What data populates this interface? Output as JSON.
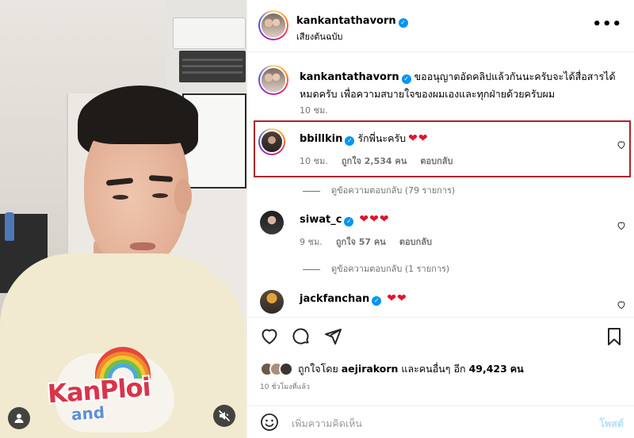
{
  "post": {
    "author": "kankantathavorn",
    "audio_label": "เสียงต้นฉบับ",
    "more_label": "•••",
    "caption": {
      "username": "kankantathavorn",
      "text": "ขออนุญาตอัดคลิปแล้วกันนะครับจะได้สื่อสารได้หมดครับ เพื่อความสบายใจของผมเองและทุกฝ่ายด้วยครับผม",
      "time": "10 ชม."
    }
  },
  "comments": [
    {
      "username": "bbillkin",
      "text": "รักพี่นะครับ",
      "hearts": "❤❤",
      "time": "10 ชม.",
      "likes": "ถูกใจ 2,534 คน",
      "reply": "ตอบกลับ",
      "replies_label": "ดูข้อความตอบกลับ (79 รายการ)"
    },
    {
      "username": "siwat_c",
      "text": "",
      "hearts": "❤❤❤",
      "time": "9 ชม.",
      "likes": "ถูกใจ 57 คน",
      "reply": "ตอบกลับ",
      "replies_label": "ดูข้อความตอบกลับ (1 รายการ)"
    },
    {
      "username": "jackfanchan",
      "text": "",
      "hearts": "❤❤"
    }
  ],
  "likes": {
    "prefix": "ถูกใจโดย",
    "user": "aejirakorn",
    "middle": "และคนอื่นๆ อีก",
    "count": "49,423",
    "suffix": "คน",
    "time_ago": "10 ชั่วโมงที่แล้ว"
  },
  "add_comment": {
    "placeholder": "เพิ่มความคิดเห็น",
    "post_label": "โพสต์"
  },
  "media": {
    "shirt_text_1": "KanPloi",
    "shirt_text_2": "and"
  },
  "colors": {
    "verified": "#0095f6",
    "heart": "#e0142d",
    "highlight_border": "#b3212b",
    "post_button": "#b2dffc"
  }
}
